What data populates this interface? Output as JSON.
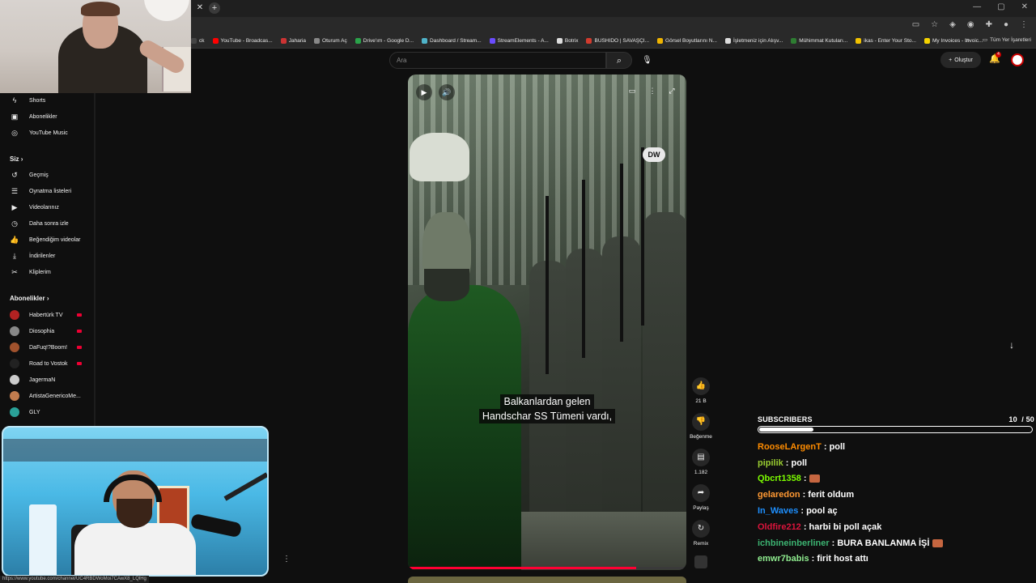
{
  "browser": {
    "bookmarks": [
      {
        "label": "ck",
        "color": "#444444"
      },
      {
        "label": "YouTube - Broadcas...",
        "color": "#ff0000"
      },
      {
        "label": "Jaharia",
        "color": "#cc3333"
      },
      {
        "label": "Oturum Aç",
        "color": "#888888"
      },
      {
        "label": "Drive'ım - Google D...",
        "color": "#2aa34a"
      },
      {
        "label": "Dashboard / Stream...",
        "color": "#4fb3c9"
      },
      {
        "label": "StreamElements - A...",
        "color": "#6a4cff"
      },
      {
        "label": "Botrix",
        "color": "#dddddd"
      },
      {
        "label": "BUSHIDO | SAVAŞÇI...",
        "color": "#d13b2e"
      },
      {
        "label": "Görsel Boyutlarını N...",
        "color": "#f0b400"
      },
      {
        "label": "İşletmeniz için Alışv...",
        "color": "#dddddd"
      },
      {
        "label": "Mühimmat Kutuları...",
        "color": "#2e7d32"
      },
      {
        "label": "ikas - Enter Your Sto...",
        "color": "#f2c200"
      },
      {
        "label": "My Invoices - Invoic...",
        "color": "#f5d300"
      }
    ],
    "more": "»",
    "all_bookmarks": "Tüm Yer İşaretleri",
    "status_url": "https://www.youtube.com/channel/UC4RBDWoMoi7CAwX8_LQlHg"
  },
  "header": {
    "search_placeholder": "Ara",
    "create_label": "Oluştur",
    "notification_count": "4"
  },
  "sidebar": {
    "items": [
      {
        "label": "Shorts",
        "icon": "shorts-icon",
        "glyph": "ϟ"
      },
      {
        "label": "Abonelikler",
        "icon": "subscriptions-icon",
        "glyph": "▣"
      },
      {
        "label": "YouTube Music",
        "icon": "music-icon",
        "glyph": "◎"
      }
    ],
    "you_heading": "Siz",
    "you_items": [
      {
        "label": "Geçmiş",
        "icon": "history-icon",
        "glyph": "↺"
      },
      {
        "label": "Oynatma listeleri",
        "icon": "playlists-icon",
        "glyph": "☰"
      },
      {
        "label": "Videolarınız",
        "icon": "your-videos-icon",
        "glyph": "▶"
      },
      {
        "label": "Daha sonra izle",
        "icon": "watch-later-icon",
        "glyph": "◷"
      },
      {
        "label": "Beğendiğim videolar",
        "icon": "liked-icon",
        "glyph": "👍"
      },
      {
        "label": "İndirilenler",
        "icon": "downloads-icon",
        "glyph": "⤓"
      },
      {
        "label": "Kliplerim",
        "icon": "clips-icon",
        "glyph": "✂"
      }
    ],
    "subs_heading": "Abonelikler",
    "channels": [
      {
        "label": "Habertürk TV",
        "color": "#b22222",
        "live": true
      },
      {
        "label": "Diosophia",
        "color": "#888888",
        "live": true
      },
      {
        "label": "DaFuq!?Boom!",
        "color": "#a0522d",
        "live": true
      },
      {
        "label": "Road to Vostok",
        "color": "#222222",
        "live": true
      },
      {
        "label": "JagermaN",
        "color": "#cccccc",
        "live": false
      },
      {
        "label": "ArtistaGenericoMe...",
        "color": "#c27c4e",
        "live": false
      },
      {
        "label": "GLY",
        "color": "#2aa198",
        "live": false
      }
    ]
  },
  "video": {
    "watermark": "DW",
    "subtitle_line1": "Balkanlardan gelen",
    "subtitle_line2": "Handschar SS Tümeni vardı,",
    "progress": 0.82,
    "likes": "21 B",
    "dislike_label": "Beğenme",
    "comments": "1.182",
    "share_label": "Paylaş",
    "remix_label": "Remix"
  },
  "overlay": {
    "subs_title": "SUBSCRIBERS",
    "subs_count": "10",
    "subs_goal": "/ 50",
    "subs_fraction": 0.2,
    "chat": [
      {
        "user": "RooseLArgenT",
        "color": "#ff8c00",
        "text": ": poll",
        "emote": false
      },
      {
        "user": "pipilik",
        "color": "#9acd32",
        "text": ": poll",
        "emote": false
      },
      {
        "user": "Qbcrt1358",
        "color": "#7cfc00",
        "text": ":",
        "emote": true
      },
      {
        "user": "gelaredon",
        "color": "#ff9933",
        "text": ": ferit oldum",
        "emote": false
      },
      {
        "user": "In_Waves",
        "color": "#1e90ff",
        "text": ": pool aç",
        "emote": false
      },
      {
        "user": "Oldfire212",
        "color": "#dc143c",
        "text": ": harbi bi poll açak",
        "emote": false
      },
      {
        "user": "ichbineinberliner",
        "color": "#3cb371",
        "text": ": BURA BANLANMA İŞİ",
        "emote": true
      },
      {
        "user": "emwr7babis",
        "color": "#90ee90",
        "text": ": firit host attı",
        "emote": false
      }
    ]
  }
}
